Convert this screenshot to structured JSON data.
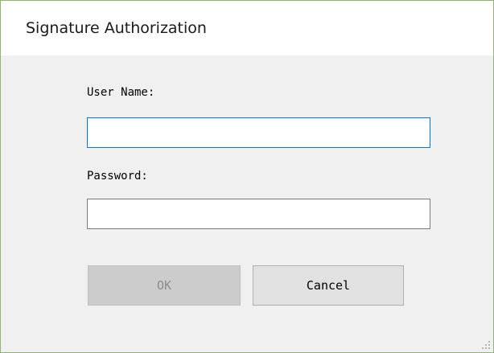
{
  "window": {
    "title": "Signature Authorization"
  },
  "form": {
    "username_label": "User Name:",
    "username_value": "",
    "password_label": "Password:",
    "password_value": ""
  },
  "buttons": {
    "ok_label": "OK",
    "cancel_label": "Cancel"
  },
  "colors": {
    "window_border": "#8fb573",
    "focus_border": "#0078d7",
    "dialog_background": "#f0f0f0",
    "disabled_button": "#cccccc"
  },
  "icons": {
    "resize_grip": "resize-grip-icon"
  }
}
